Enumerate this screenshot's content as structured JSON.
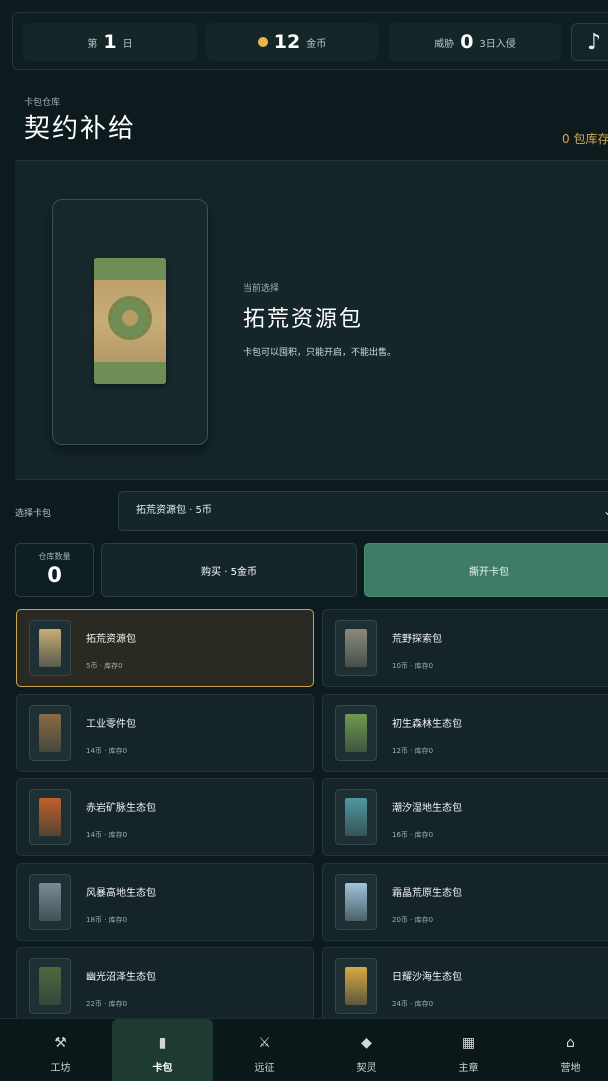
{
  "top": {
    "day_prefix": "第",
    "day_value": "1",
    "day_suffix": "日",
    "coins_value": "12",
    "coins_suffix": "金币",
    "threat_prefix": "威胁",
    "threat_value": "0",
    "threat_suffix": "3日入侵",
    "music_icon": "♪"
  },
  "header": {
    "sublabel": "卡包仓库",
    "title": "契约补给",
    "stock_note": "0 包库存"
  },
  "showcase": {
    "current_label": "当前选择",
    "current_name": "拓荒资源包",
    "description": "卡包可以囤积，只能开启，不能出售。"
  },
  "selector": {
    "label": "选择卡包",
    "selected": "拓荒资源包 · 5币",
    "chevron": "⌄"
  },
  "actions": {
    "qty_label": "仓库数量",
    "qty_value": "0",
    "buy_label": "购买 · 5金币",
    "open_label": "撕开卡包"
  },
  "packs": [
    {
      "name": "拓荒资源包",
      "meta": "5币 · 库存0",
      "color": "#c8ad76",
      "selected": true
    },
    {
      "name": "荒野探索包",
      "meta": "10币 · 库存0",
      "color": "#8a8a78"
    },
    {
      "name": "工业零件包",
      "meta": "14币 · 库存0",
      "color": "#8a6a44"
    },
    {
      "name": "初生森林生态包",
      "meta": "12币 · 库存0",
      "color": "#6f9a4e"
    },
    {
      "name": "赤岩矿脉生态包",
      "meta": "14币 · 库存0",
      "color": "#c0602a"
    },
    {
      "name": "潮汐湿地生态包",
      "meta": "16币 · 库存0",
      "color": "#4f98a0"
    },
    {
      "name": "风暴高地生态包",
      "meta": "18币 · 库存0",
      "color": "#7d8a98"
    },
    {
      "name": "霜晶荒原生态包",
      "meta": "20币 · 库存0",
      "color": "#9fc4dc"
    },
    {
      "name": "幽光沼泽生态包",
      "meta": "22币 · 库存0",
      "color": "#4c6a3c"
    },
    {
      "name": "日耀沙海生态包",
      "meta": "24币 · 库存0",
      "color": "#d9a844"
    }
  ],
  "nav": [
    {
      "label": "工坊",
      "icon": "⚒"
    },
    {
      "label": "卡包",
      "icon": "▮"
    },
    {
      "label": "远征",
      "icon": "⚔"
    },
    {
      "label": "契灵",
      "icon": "◆"
    },
    {
      "label": "主章",
      "icon": "▦"
    },
    {
      "label": "营地",
      "icon": "⌂"
    }
  ],
  "colors": {
    "accent": "#3f7c68",
    "gold": "#caa653",
    "background": "#0d1a1e"
  }
}
